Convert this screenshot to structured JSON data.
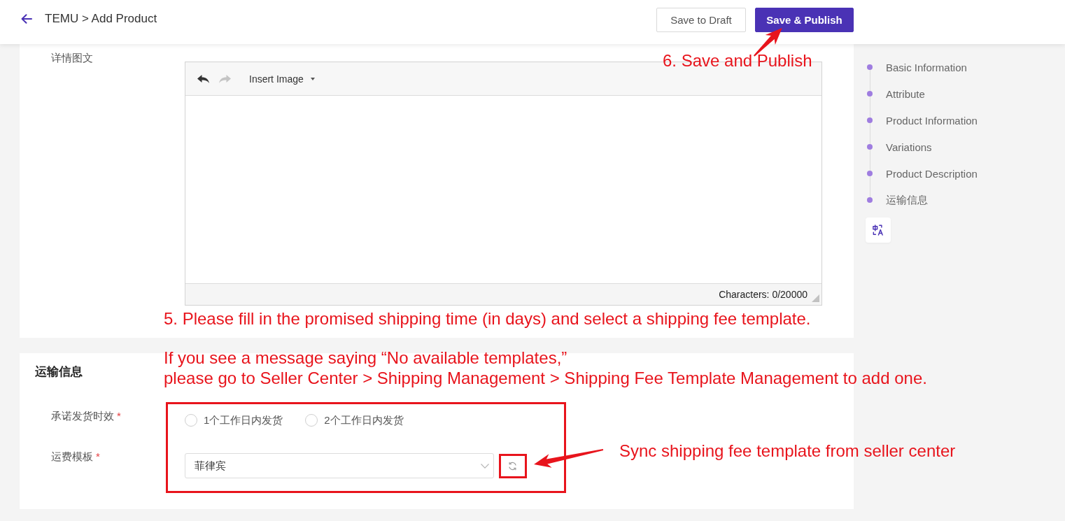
{
  "header": {
    "title": "TEMU > Add Product",
    "buttons": [
      {
        "kind": "secondary",
        "label": "Save to Draft"
      },
      {
        "kind": "primary",
        "label": "Save & Publish"
      }
    ]
  },
  "description": {
    "label": "详情图文",
    "editor": {
      "toolbar": [
        {
          "kind": "undo",
          "disabled": false
        },
        {
          "kind": "redo",
          "disabled": true
        },
        {
          "kind": "dropdown",
          "label": "Insert Image"
        }
      ],
      "counter": "Characters: 0/20000"
    }
  },
  "shipping": {
    "title": "运输信息",
    "fields": [
      {
        "kind": "radio",
        "label": "承诺发货时效",
        "required_mark": "*",
        "options": [
          {
            "label": "1个工作日内发货",
            "selected": false
          },
          {
            "label": "2个工作日内发货",
            "selected": false
          }
        ]
      },
      {
        "kind": "select",
        "label": "运费模板",
        "required_mark": "*",
        "value": "菲律宾"
      }
    ]
  },
  "section_nav": {
    "items": [
      "Basic Information",
      "Attribute",
      "Product Information",
      "Variations",
      "Product Description",
      "运输信息"
    ]
  },
  "annotations": [
    {
      "kind": "arrow"
    },
    {
      "kind": "note",
      "text": "6. Save and Publish"
    },
    {
      "kind": "note",
      "text": "5. Please fill in the promised shipping time (in days) and select a shipping fee template."
    },
    {
      "kind": "note",
      "text": "If you see a message saying “No available templates,”\nplease go to Seller Center > Shipping Management > Shipping Fee Template Management to add one."
    },
    {
      "kind": "box"
    },
    {
      "kind": "box"
    },
    {
      "kind": "arrow"
    },
    {
      "kind": "note",
      "text": "Sync shipping fee template from seller center"
    }
  ]
}
